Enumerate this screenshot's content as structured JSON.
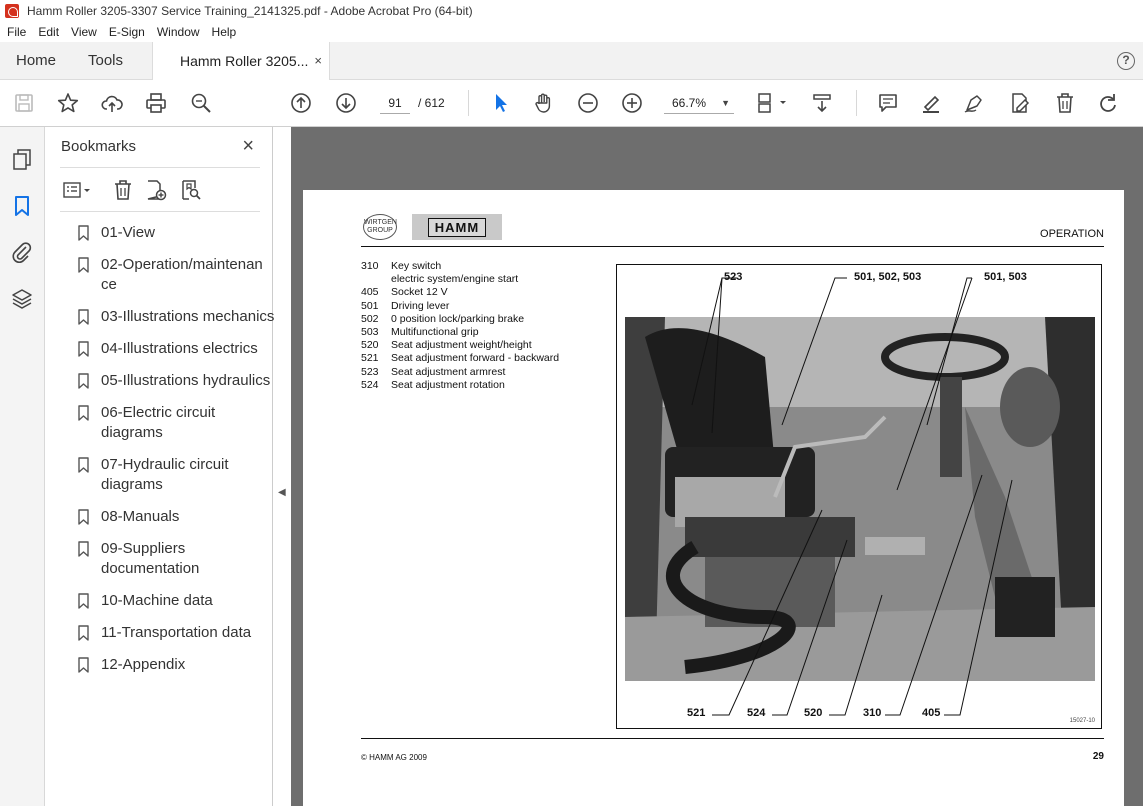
{
  "window": {
    "title": "Hamm Roller 3205-3307 Service Training_2141325.pdf - Adobe Acrobat Pro (64-bit)"
  },
  "menu": [
    "File",
    "Edit",
    "View",
    "E-Sign",
    "Window",
    "Help"
  ],
  "tabs": {
    "home": "Home",
    "tools": "Tools",
    "doc": "Hamm Roller 3205...",
    "close": "×",
    "help": "?"
  },
  "toolbar": {
    "page_current": "91",
    "page_total": "/ 612",
    "zoom": "66.7%"
  },
  "bookmarks": {
    "title": "Bookmarks",
    "close": "×",
    "items": [
      "01-View",
      "02-Operation/maintenan ce",
      "03-Illustrations mechanics",
      "04-Illustrations electrics",
      "05-Illustrations hydraulics",
      "06-Electric circuit diagrams",
      "07-Hydraulic circuit diagrams",
      "08-Manuals",
      "09-Suppliers documentation",
      "10-Machine data",
      "11-Transportation data",
      "12-Appendix"
    ]
  },
  "pdf_page": {
    "logo_wirtgen": "WIRTGEN GROUP",
    "logo_hamm": "HAMM",
    "section": "OPERATION",
    "legend": [
      {
        "num": "310",
        "text": "Key switch"
      },
      {
        "num": "",
        "text": "electric system/engine start"
      },
      {
        "num": "405",
        "text": "Socket 12 V"
      },
      {
        "num": "501",
        "text": "Driving lever"
      },
      {
        "num": "502",
        "text": "0 position lock/parking brake"
      },
      {
        "num": "503",
        "text": "Multifunctional grip"
      },
      {
        "num": "520",
        "text": "Seat adjustment weight/height"
      },
      {
        "num": "521",
        "text": "Seat adjustment forward - backward"
      },
      {
        "num": "523",
        "text": "Seat adjustment armrest"
      },
      {
        "num": "524",
        "text": "Seat adjustment rotation"
      }
    ],
    "callouts_top": [
      "523",
      "501, 502, 503",
      "501, 503"
    ],
    "callouts_bottom": [
      "521",
      "524",
      "520",
      "310",
      "405"
    ],
    "figure_id": "15027-10",
    "copyright": "© HAMM AG 2009",
    "page_number": "29"
  }
}
